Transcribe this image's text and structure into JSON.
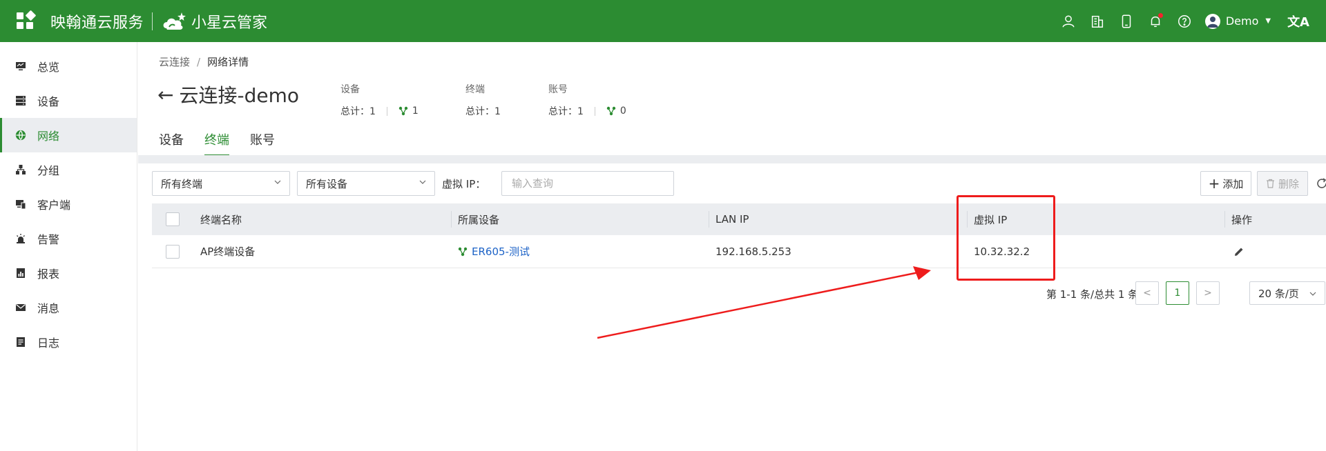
{
  "topbar": {
    "brand": "映翰通云服务",
    "brand2": "小星云管家",
    "user_name": "Demo",
    "lang_glyph": "文A",
    "icons": [
      "user-icon",
      "building-icon",
      "mobile-icon",
      "bell-icon",
      "help-icon"
    ]
  },
  "sidebar": {
    "items": [
      {
        "label": "总览",
        "icon": "monitor-icon"
      },
      {
        "label": "设备",
        "icon": "server-icon"
      },
      {
        "label": "网络",
        "icon": "globe-icon",
        "active": true
      },
      {
        "label": "分组",
        "icon": "hierarchy-icon"
      },
      {
        "label": "客户端",
        "icon": "client-icon"
      },
      {
        "label": "告警",
        "icon": "alarm-icon"
      },
      {
        "label": "报表",
        "icon": "report-icon"
      },
      {
        "label": "消息",
        "icon": "mail-icon"
      },
      {
        "label": "日志",
        "icon": "log-icon"
      }
    ]
  },
  "breadcrumb": {
    "root": "云连接",
    "sep": "/",
    "current": "网络详情"
  },
  "page_title": "云连接-demo",
  "stats": [
    {
      "label": "设备",
      "total": "总计：1",
      "net": "1"
    },
    {
      "label": "终端",
      "total": "总计：1"
    },
    {
      "label": "账号",
      "total": "总计：1",
      "net": "0"
    }
  ],
  "tabs": [
    {
      "label": "设备"
    },
    {
      "label": "终端",
      "active": true
    },
    {
      "label": "账号"
    }
  ],
  "filters": {
    "terminal_select": "所有终端",
    "device_select": "所有设备",
    "vip_label": "虚拟 IP：",
    "vip_placeholder": "输入查询"
  },
  "actions": {
    "add": "添加",
    "delete": "删除"
  },
  "table": {
    "headers": [
      "终端名称",
      "所属设备",
      "LAN IP",
      "虚拟 IP",
      "操作"
    ],
    "rows": [
      {
        "name": "AP终端设备",
        "device": "ER605-测试",
        "lan_ip": "192.168.5.253",
        "virtual_ip": "10.32.32.2"
      }
    ]
  },
  "pagination": {
    "summary": "第 1-1 条/总共 1 条",
    "current_page": "1",
    "page_size": "20 条/页"
  },
  "colors": {
    "brand_green": "#2c8c32",
    "link_blue": "#1d63c7",
    "annotation_red": "#ee1c1c"
  }
}
